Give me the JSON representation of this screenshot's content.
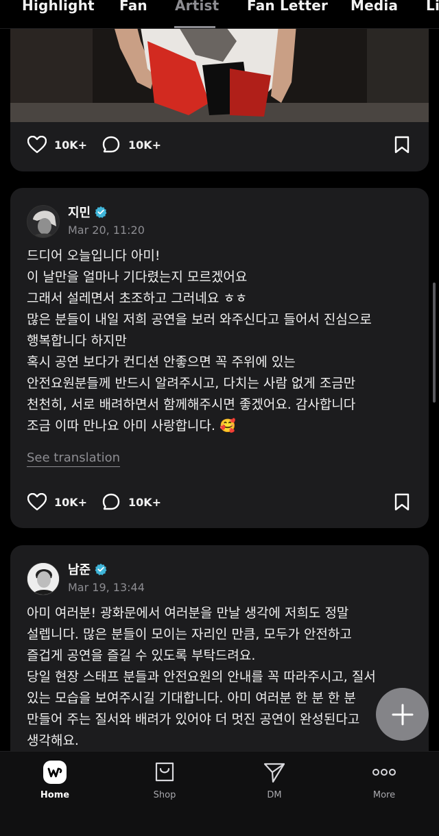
{
  "tabs": [
    {
      "label": "Highlight",
      "active": false
    },
    {
      "label": "Fan",
      "active": false
    },
    {
      "label": "Artist",
      "active": true
    },
    {
      "label": "Fan Letter",
      "active": false
    },
    {
      "label": "Media",
      "active": false
    },
    {
      "label": "Li",
      "active": false
    }
  ],
  "posts": [
    {
      "likes": "10K+",
      "comments": "10K+"
    },
    {
      "author": "지민",
      "time": "Mar 20, 11:20",
      "lines": [
        "드디어 오늘입니다 아미!",
        "이 날만을 얼마나 기다렸는지 모르겠어요",
        "그래서 설레면서 초조하고 그러네요 ㅎㅎ",
        "많은 분들이 내일 저희 공연을 보러 와주신다고 들어서 진심으로",
        "행복합니다 하지만",
        "혹시 공연 보다가 컨디션 안좋으면 꼭 주위에 있는",
        "안전요원분들께 반드시 알려주시고, 다치는 사람 없게 조금만",
        "천천히, 서로 배려하면서 함께해주시면 좋겠어요. 감사합니다",
        "조금 이따 만나요 아미 사랑합니다. 🥰"
      ],
      "see_translation": "See translation",
      "likes": "10K+",
      "comments": "10K+"
    },
    {
      "author": "남준",
      "time": "Mar 19, 13:44",
      "lines": [
        "아미 여러분! 광화문에서 여러분을 만날 생각에 저희도 정말",
        "설렙니다. 많은 분들이 모이는 자리인 만큼, 모두가 안전하고",
        "즐겁게 공연을 즐길 수 있도록 부탁드려요.",
        "당일 현장 스태프 분들과 안전요원의 안내를 꼭 따라주시고, 질서",
        "있는 모습을 보여주시길 기대합니다. 아미 여러분 한 분 한 분",
        "만들어 주는 질서와 배려가 있어야 더 멋진 공연이 완성된다고",
        "생각해요."
      ]
    }
  ],
  "bottom_nav": [
    {
      "label": "Home",
      "icon": "weverse-logo-icon",
      "active": true
    },
    {
      "label": "Shop",
      "icon": "shopping-bag-icon",
      "active": false
    },
    {
      "label": "DM",
      "icon": "paper-plane-icon",
      "active": false
    },
    {
      "label": "More",
      "icon": "more-dots-icon",
      "active": false
    }
  ],
  "colors": {
    "background": "#000000",
    "card": "#1c1c1e",
    "muted_text": "#8d8d92",
    "verified_badge": "#3fb5d9",
    "fab": "#8c8c90"
  }
}
